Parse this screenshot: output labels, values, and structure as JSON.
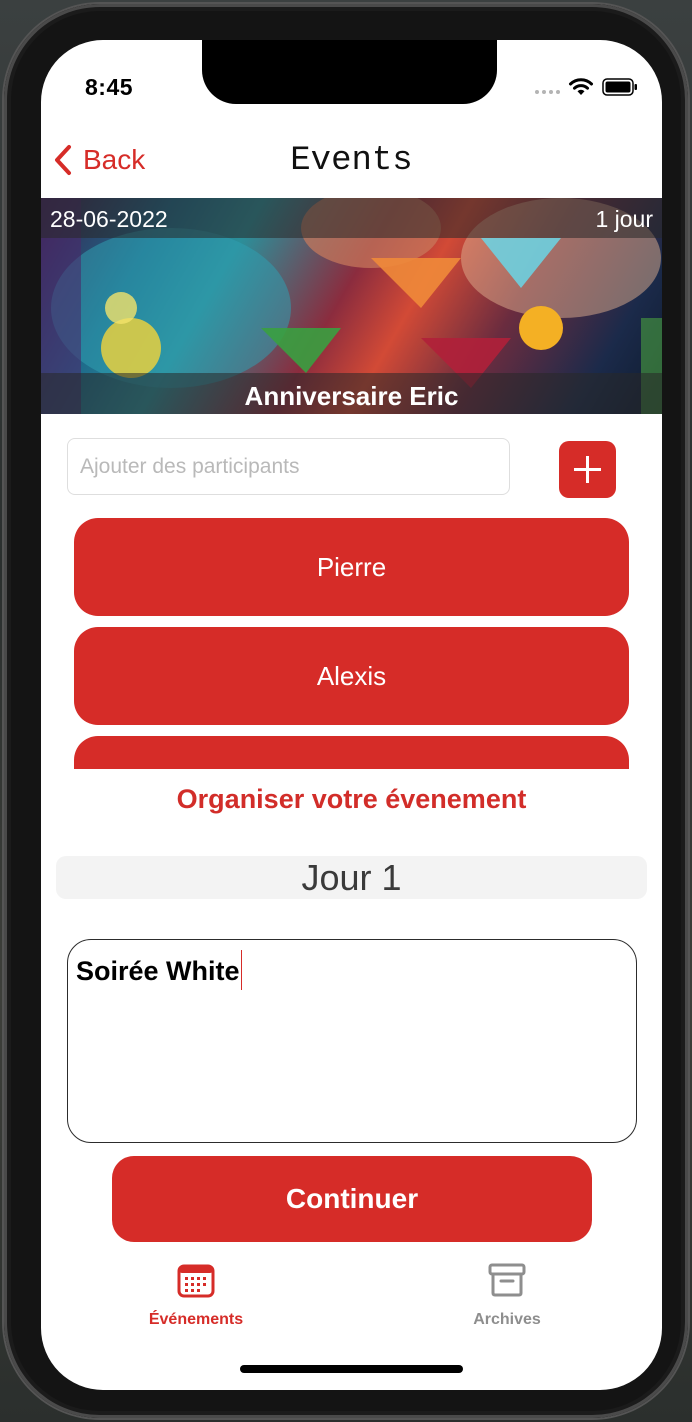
{
  "status_bar": {
    "time": "8:45"
  },
  "nav": {
    "back_label": "Back",
    "title": "Events"
  },
  "event": {
    "date": "28-06-2022",
    "duration": "1 jour",
    "name": "Anniversaire Eric"
  },
  "participants": {
    "input_placeholder": "Ajouter des participants",
    "items": [
      {
        "name": "Pierre"
      },
      {
        "name": "Alexis"
      },
      {
        "name": ""
      }
    ]
  },
  "organize": {
    "title": "Organiser votre évenement",
    "day_label": "Jour 1",
    "notes_value": "Soirée White"
  },
  "continue_label": "Continuer",
  "tabbar": {
    "items": [
      {
        "label": "Événements",
        "icon": "calendar-icon",
        "active": true
      },
      {
        "label": "Archives",
        "icon": "archive-box-icon",
        "active": false
      }
    ]
  },
  "colors": {
    "accent": "#d62c28",
    "inactive": "#8e8e8e"
  }
}
